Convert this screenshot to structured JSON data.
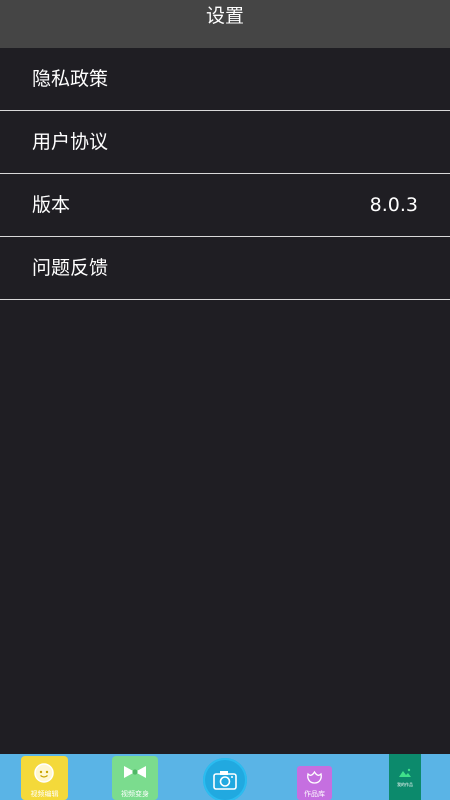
{
  "header": {
    "title": "设置"
  },
  "menu": [
    {
      "label": "隐私政策",
      "value": ""
    },
    {
      "label": "用户协议",
      "value": ""
    },
    {
      "label": "版本",
      "value": "8.0.3"
    },
    {
      "label": "问题反馈",
      "value": ""
    }
  ],
  "tabbar": {
    "tabs": [
      {
        "label": "视频编辑",
        "icon": "face-icon"
      },
      {
        "label": "视频变身",
        "icon": "bow-icon"
      },
      {
        "label": "",
        "icon": "camera-icon"
      },
      {
        "label": "作品库",
        "icon": "flower-icon"
      },
      {
        "label": "我的作品",
        "icon": "mountain-icon"
      }
    ]
  },
  "colors": {
    "background": "#1f1e23",
    "header": "#454545",
    "divider": "#d9d9d9",
    "tabbar": "#5ab4e6"
  }
}
